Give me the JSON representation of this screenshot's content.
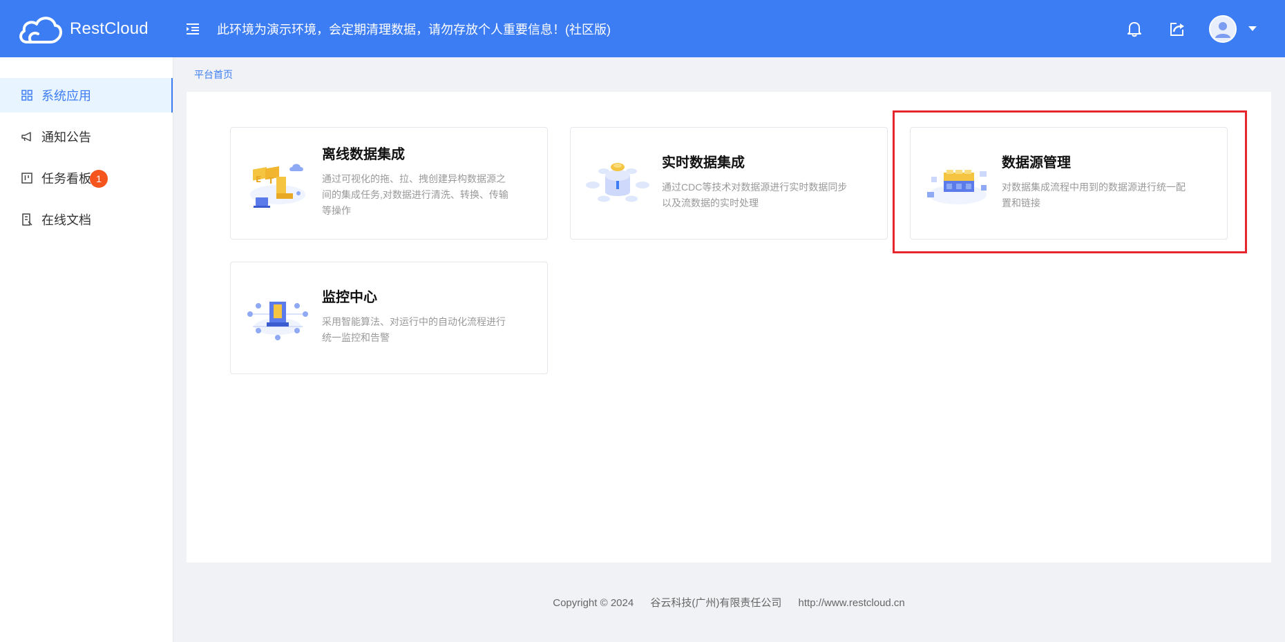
{
  "header": {
    "brand": "RestCloud",
    "notice": "此环境为演示环境，会定期清理数据，请勿存放个人重要信息！(社区版)",
    "colors": {
      "primary": "#3d7df4",
      "badge": "#f5541d",
      "highlight": "#e5262c"
    }
  },
  "sidebar": {
    "items": [
      {
        "label": "系统应用",
        "icon": "grid-icon",
        "active": true
      },
      {
        "label": "通知公告",
        "icon": "megaphone-icon"
      },
      {
        "label": "任务看板",
        "icon": "kanban-icon",
        "badge": "1"
      },
      {
        "label": "在线文档",
        "icon": "document-icon"
      }
    ]
  },
  "breadcrumb": "平台首页",
  "cards": [
    {
      "title": "离线数据集成",
      "desc": "通过可视化的拖、拉、拽创建异构数据源之间的集成任务,对数据进行清洗、转换、传输等操作",
      "icon": "etl-illustration"
    },
    {
      "title": "实时数据集成",
      "desc": "通过CDC等技术对数据源进行实时数据同步以及流数据的实时处理",
      "icon": "realtime-illustration"
    },
    {
      "title": "数据源管理",
      "desc": "对数据集成流程中用到的数据源进行统一配置和链接",
      "icon": "datasource-illustration"
    },
    {
      "title": "监控中心",
      "desc": "采用智能算法、对运行中的自动化流程进行统一监控和告警",
      "icon": "monitor-illustration"
    }
  ],
  "footer": {
    "copyright": "Copyright © 2024",
    "company": "谷云科技(广州)有限责任公司",
    "url": "http://www.restcloud.cn"
  }
}
